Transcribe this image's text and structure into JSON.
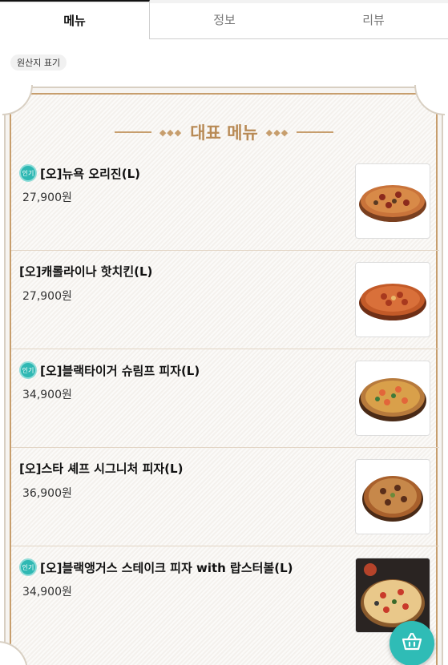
{
  "tabs": [
    {
      "label": "메뉴",
      "active": true
    },
    {
      "label": "정보",
      "active": false
    },
    {
      "label": "리뷰",
      "active": false
    }
  ],
  "origin_badge": "원산지 표기",
  "section": {
    "title": "대표 메뉴",
    "accent_color": "#b88a55"
  },
  "popular_badge": "인기",
  "menu_items": [
    {
      "name": "[오]뉴욕 오리진(L)",
      "price": "27,900원",
      "popular": true
    },
    {
      "name": "[오]캐롤라이나 핫치킨(L)",
      "price": "27,900원",
      "popular": false
    },
    {
      "name": "[오]블랙타이거 슈림프 피자(L)",
      "price": "34,900원",
      "popular": true
    },
    {
      "name": "[오]스타 셰프 시그니처 피자(L)",
      "price": "36,900원",
      "popular": false
    },
    {
      "name": "[오]블랙앵거스 스테이크 피자 with 랍스터볼(L)",
      "price": "34,900원",
      "popular": true
    }
  ],
  "cart_button_icon": "basket-icon",
  "colors": {
    "teal": "#2fbcb6",
    "gold": "#c79e6d"
  }
}
